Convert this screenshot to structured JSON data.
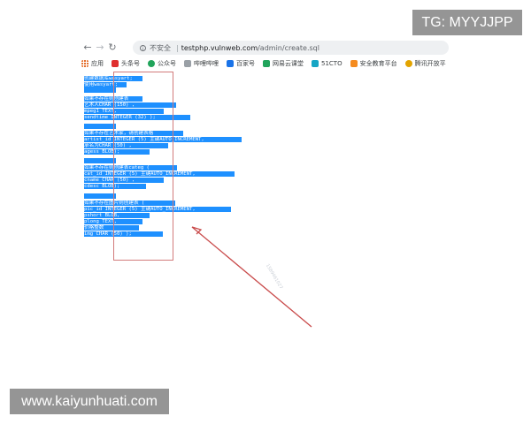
{
  "browser": {
    "security_label": "不安全",
    "url_host": "testphp.vulnweb.com",
    "url_path": "/admin/create.sql",
    "bookmarks": [
      {
        "label": "应用",
        "icon": "apps-grid-icon"
      },
      {
        "label": "头条号",
        "icon": "red-square-icon"
      },
      {
        "label": "公众号",
        "icon": "green-circle-icon"
      },
      {
        "label": "哔哩哔哩",
        "icon": "gray-square-icon"
      },
      {
        "label": "百家号",
        "icon": "blue-square-icon"
      },
      {
        "label": "网易云课堂",
        "icon": "green-square-icon"
      },
      {
        "label": "51CTO",
        "icon": "cyan-square-icon"
      },
      {
        "label": "安全教育平台",
        "icon": "orange-square-icon"
      },
      {
        "label": "腾讯开放平",
        "icon": "yellow-circle-icon"
      }
    ]
  },
  "code_lines": [
    "创建数据库wasyart;",
    "使用wasyart;",
    "",
    "如果不存在则创建表",
    "    艺术人CHAR (150) ,",
    "    mpeg1 TEXT,",
    "    sendtime INTEGER (32) );",
    "",
    "如果不存在艺术家，请创建表格",
    "    artist_id INTEGER (5) 主键AUTO_INCREMENT,",
    "    承名为CHAR (50) ,",
    "    agess BLOB);",
    "",
    "如果不存在则创建表categ (",
    "    cat_id INTEGER (5) 主键AUTO_INCREMENT,",
    "    cname CHAR (50) ,",
    "    cdesc BLOB);",
    "",
    "如果不存在图片则创建表 (",
    "    pic_id INTEGER (5) 主键AUTO_INCREMENT,",
    "    pshort BLOB,",
    "    plong TEXT,",
    "    价格整数",
    "    img CHAR (50) );"
  ],
  "watermark_text": "1589461027",
  "tg_label": "TG: MYYJJPP",
  "site_label": "www.kaiyunhuati.com",
  "colors": {
    "selection_blue": "#1e90ff",
    "annotation_red": "#d27b7b",
    "arrow_red": "#c94b4b",
    "overlay_gray": "#7b7b7b"
  }
}
